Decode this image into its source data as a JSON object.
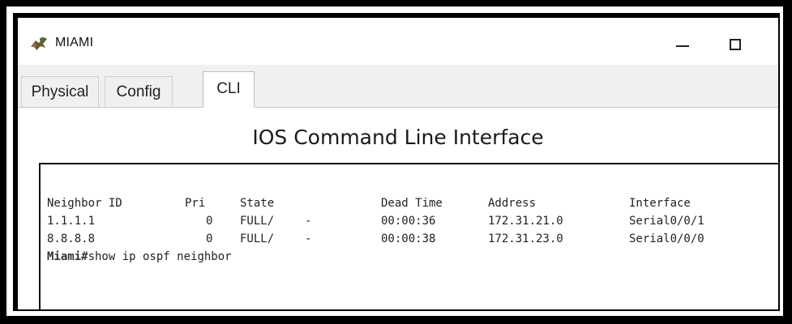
{
  "window": {
    "title": "MIAMI",
    "icon": "router-device-icon",
    "controls": [
      "minimize-icon",
      "maximize-icon"
    ]
  },
  "tabs": [
    {
      "label": "Physical",
      "active": false
    },
    {
      "label": "Config",
      "active": false
    },
    {
      "label": "CLI",
      "active": true
    }
  ],
  "cli": {
    "heading": "IOS Command Line Interface",
    "table": {
      "headers": {
        "neighbor_id": "Neighbor ID",
        "pri": "Pri",
        "state": "State",
        "dead_time": "Dead Time",
        "address": "Address",
        "interface": "Interface"
      },
      "rows": [
        {
          "neighbor_id": "1.1.1.1",
          "pri": "0",
          "state": "FULL/",
          "dash": "-",
          "dead_time": "00:00:36",
          "address": "172.31.21.0",
          "interface": "Serial0/0/1"
        },
        {
          "neighbor_id": "8.8.8.8",
          "pri": "0",
          "state": "FULL/",
          "dash": "-",
          "dead_time": "00:00:38",
          "address": "172.31.23.0",
          "interface": "Serial0/0/0"
        }
      ]
    },
    "prompt": {
      "host": "Miami#",
      "command": "show ip ospf neighbor"
    }
  },
  "colors": {
    "frame": "#000000",
    "window_bg": "#ffffff",
    "tabbar_bg": "#f0f0f0"
  }
}
